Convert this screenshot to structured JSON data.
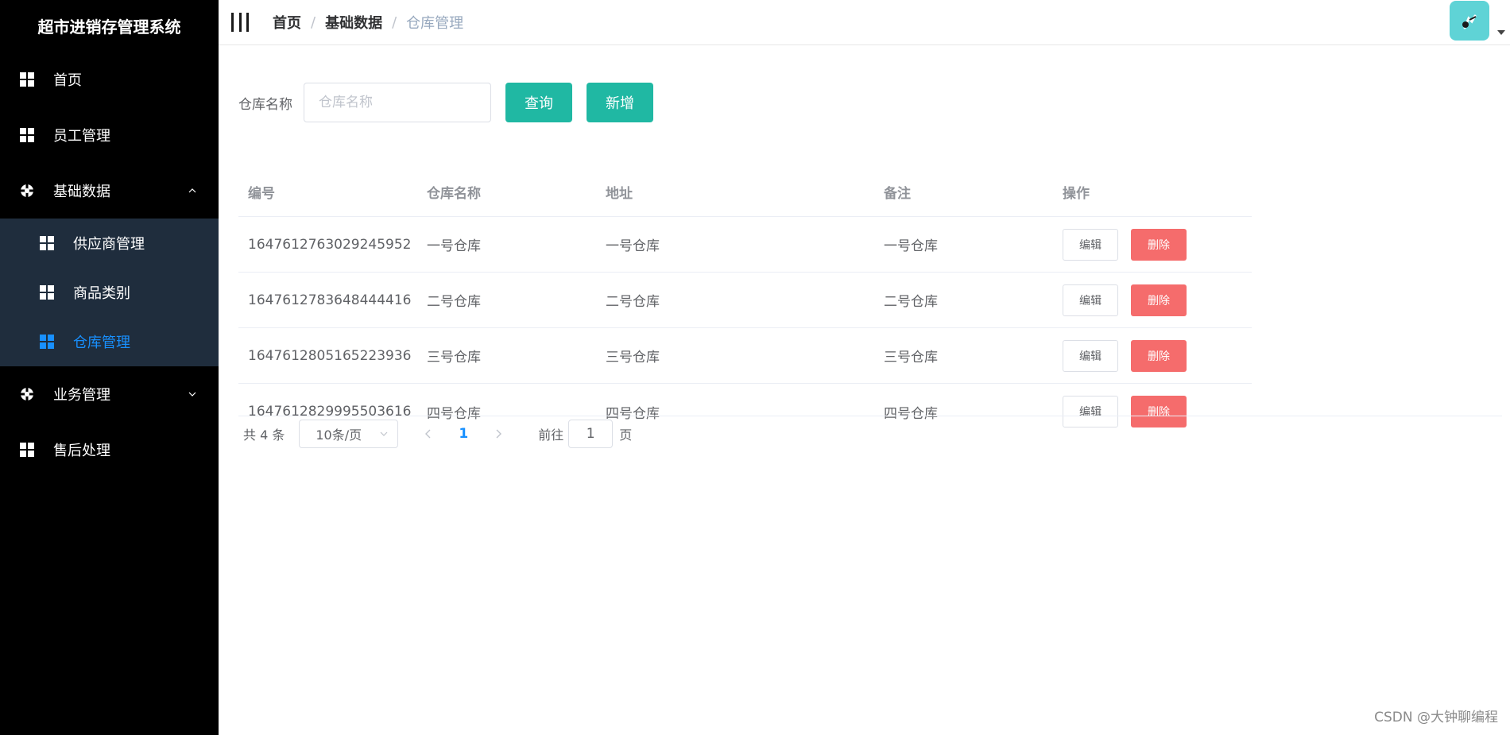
{
  "app": {
    "title": "超市进销存管理系统"
  },
  "sidebar": {
    "items": [
      {
        "label": "首页",
        "icon": "grid-icon"
      },
      {
        "label": "员工管理",
        "icon": "grid-icon"
      },
      {
        "label": "基础数据",
        "icon": "settings-icon",
        "expanded": true,
        "children": [
          {
            "label": "供应商管理",
            "icon": "grid-icon"
          },
          {
            "label": "商品类别",
            "icon": "grid-icon"
          },
          {
            "label": "仓库管理",
            "icon": "grid-icon",
            "active": true
          }
        ]
      },
      {
        "label": "业务管理",
        "icon": "settings-icon",
        "expanded": false
      },
      {
        "label": "售后处理",
        "icon": "grid-icon"
      }
    ],
    "active_color": "#1890ff"
  },
  "header": {
    "breadcrumb": [
      "首页",
      "基础数据",
      "仓库管理"
    ],
    "separator": "/"
  },
  "search": {
    "label": "仓库名称",
    "placeholder": "仓库名称",
    "value": "",
    "query_button": "查询",
    "add_button": "新增"
  },
  "table": {
    "columns": [
      "编号",
      "仓库名称",
      "地址",
      "备注",
      "操作"
    ],
    "rows": [
      {
        "id": "1647612763029245952",
        "name": "一号仓库",
        "address": "一号仓库",
        "remark": "一号仓库"
      },
      {
        "id": "1647612783648444416",
        "name": "二号仓库",
        "address": "二号仓库",
        "remark": "二号仓库"
      },
      {
        "id": "1647612805165223936",
        "name": "三号仓库",
        "address": "三号仓库",
        "remark": "三号仓库"
      },
      {
        "id": "1647612829995503616",
        "name": "四号仓库",
        "address": "四号仓库",
        "remark": "四号仓库"
      }
    ],
    "edit_label": "编辑",
    "delete_label": "删除"
  },
  "pagination": {
    "total_text": "共 4 条",
    "page_size": "10条/页",
    "current_page": "1",
    "goto_prefix": "前往",
    "goto_value": "1",
    "goto_suffix": "页"
  },
  "watermark": "CSDN @大钟聊编程",
  "colors": {
    "sidebar_bg": "#000000",
    "submenu_bg": "#1f2d3d",
    "primary": "#20b8a3",
    "danger": "#f56c6c",
    "avatar_bg": "#5fd3d6"
  }
}
